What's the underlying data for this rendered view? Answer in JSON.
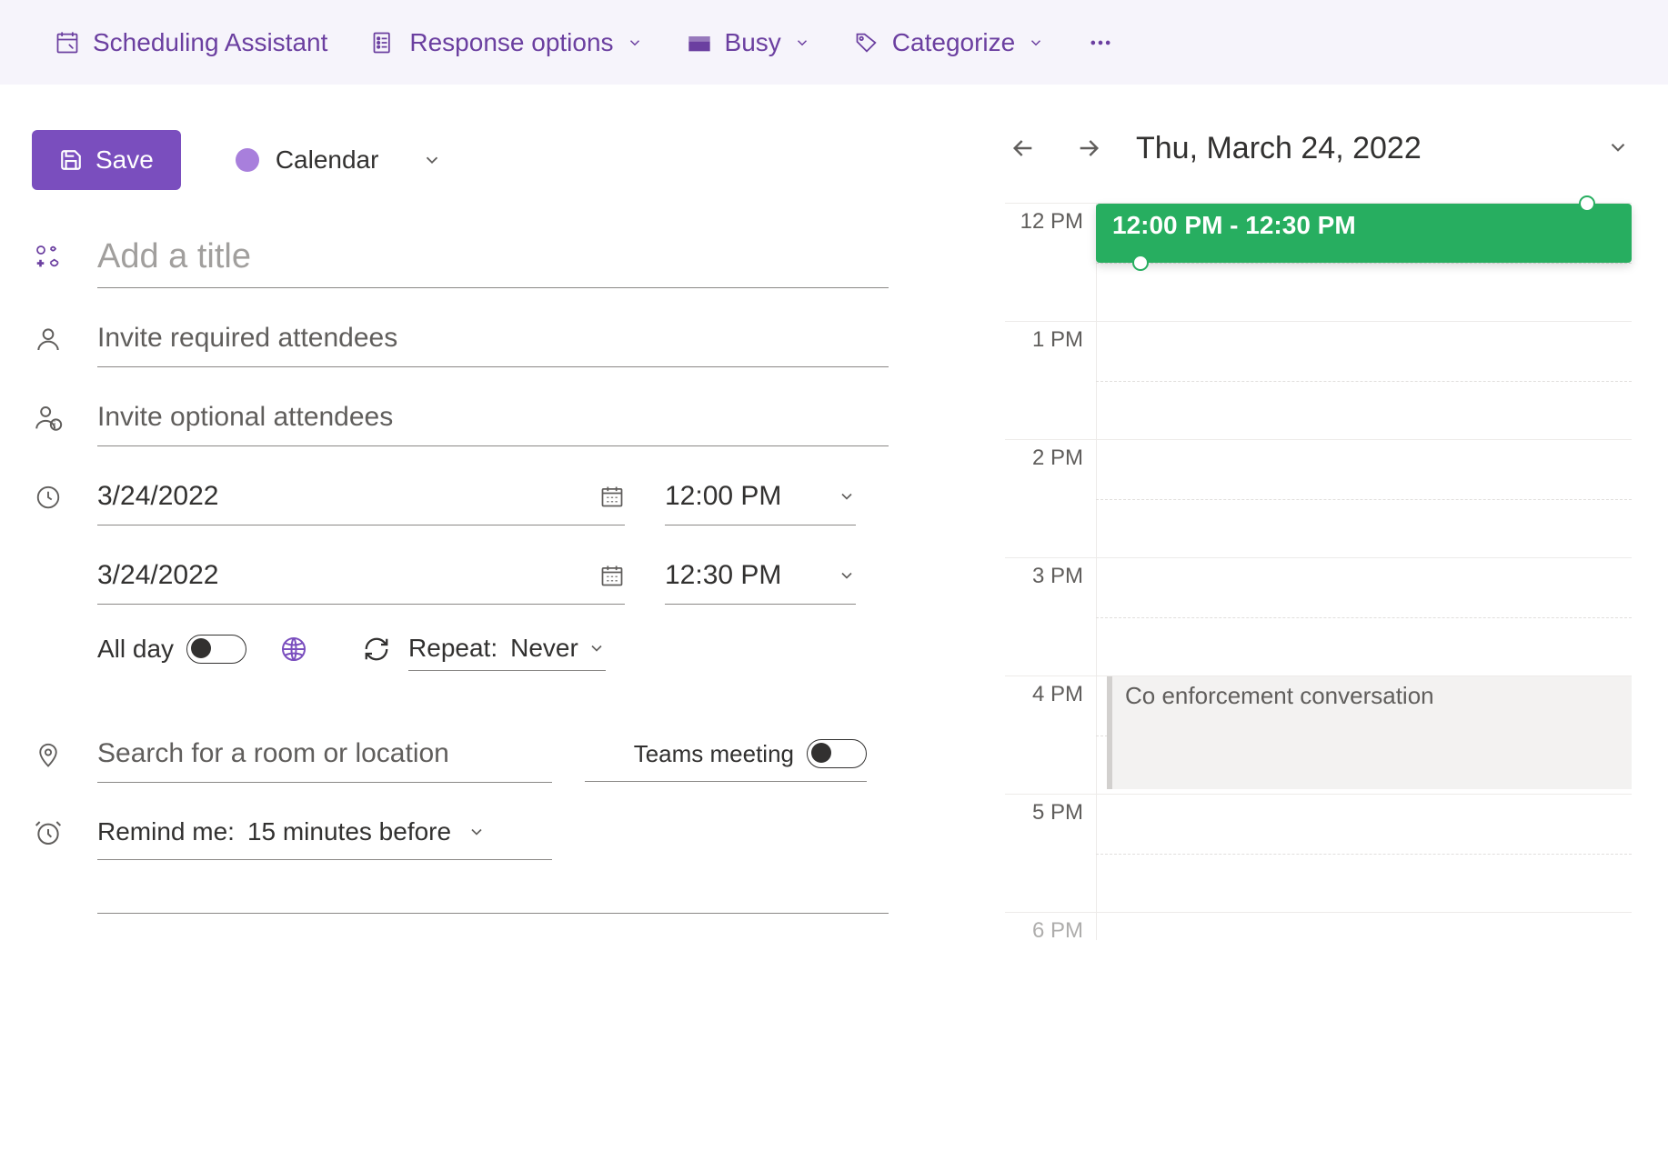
{
  "toolbar": {
    "scheduling_assistant": "Scheduling Assistant",
    "response_options": "Response options",
    "busy": "Busy",
    "categorize": "Categorize"
  },
  "save_label": "Save",
  "calendar_selector": "Calendar",
  "title_placeholder": "Add a title",
  "required_placeholder": "Invite required attendees",
  "optional_placeholder": "Invite optional attendees",
  "start_date": "3/24/2022",
  "start_time": "12:00 PM",
  "end_date": "3/24/2022",
  "end_time": "12:30 PM",
  "all_day_label": "All day",
  "repeat_label": "Repeat:",
  "repeat_value": "Never",
  "location_placeholder": "Search for a room or location",
  "teams_label": "Teams meeting",
  "remind_label": "Remind me:",
  "remind_value": "15 minutes before",
  "calendar": {
    "date": "Thu, March 24, 2022",
    "hours": [
      "12 PM",
      "1 PM",
      "2 PM",
      "3 PM",
      "4 PM",
      "5 PM",
      "6 PM"
    ],
    "new_event_label": "12:00 PM - 12:30 PM",
    "existing_event": "Co enforcement conversation"
  }
}
